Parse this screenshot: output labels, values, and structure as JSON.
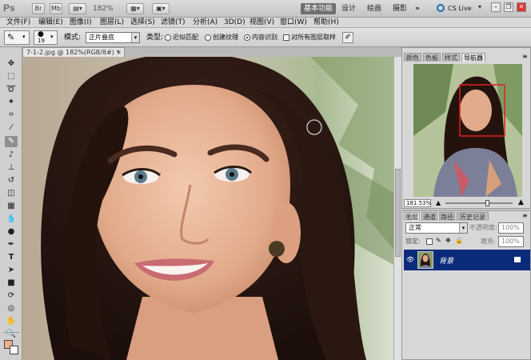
{
  "app_bar": {
    "logo": "Ps",
    "br_label": "Br",
    "mb_label": "Mb",
    "zoom": "182%",
    "workspaces": [
      "基本功能",
      "设计",
      "绘画",
      "摄影"
    ],
    "more": "»",
    "cs_live": "CS Live"
  },
  "menu": [
    "文件(F)",
    "编辑(E)",
    "图像(I)",
    "图层(L)",
    "选择(S)",
    "滤镜(T)",
    "分析(A)",
    "3D(D)",
    "视图(V)",
    "窗口(W)",
    "帮助(H)"
  ],
  "options": {
    "brush_size": "19",
    "mode_label": "模式:",
    "mode_value": "正片叠底",
    "type_label": "类型:",
    "type_options": [
      "近似匹配",
      "创建纹理",
      "内容识别"
    ],
    "type_selected": 2,
    "sample_all": "对所有图层取样"
  },
  "document": {
    "tab_title": "7-1-2.jpg @ 182%(RGB/8#) *"
  },
  "navigator": {
    "tabs": [
      "颜色",
      "色板",
      "样式",
      "导航器"
    ],
    "active_tab": 3,
    "zoom": "181.53%"
  },
  "layers": {
    "tabs": [
      "图层",
      "通道",
      "路径",
      "历史记录"
    ],
    "active_tab": 0,
    "blend_mode": "正常",
    "opacity_label": "不透明度:",
    "opacity": "100%",
    "lock_label": "锁定:",
    "fill_label": "填充:",
    "fill": "100%",
    "items": [
      {
        "name": "背景"
      }
    ]
  },
  "colors": {
    "foreground": "#eab38f",
    "background": "#ffffff",
    "layer_selected": "#0a2b7a"
  },
  "tools": [
    "move-icon",
    "marquee-icon",
    "lasso-icon",
    "quick-select-icon",
    "crop-icon",
    "eyedropper-icon",
    "healing-brush-icon",
    "brush-icon",
    "clone-stamp-icon",
    "history-brush-icon",
    "eraser-icon",
    "gradient-icon",
    "blur-icon",
    "dodge-icon",
    "pen-icon",
    "type-icon",
    "path-select-icon",
    "shape-icon",
    "3d-rotate-icon",
    "3d-orbit-icon",
    "hand-icon",
    "zoom-icon"
  ]
}
